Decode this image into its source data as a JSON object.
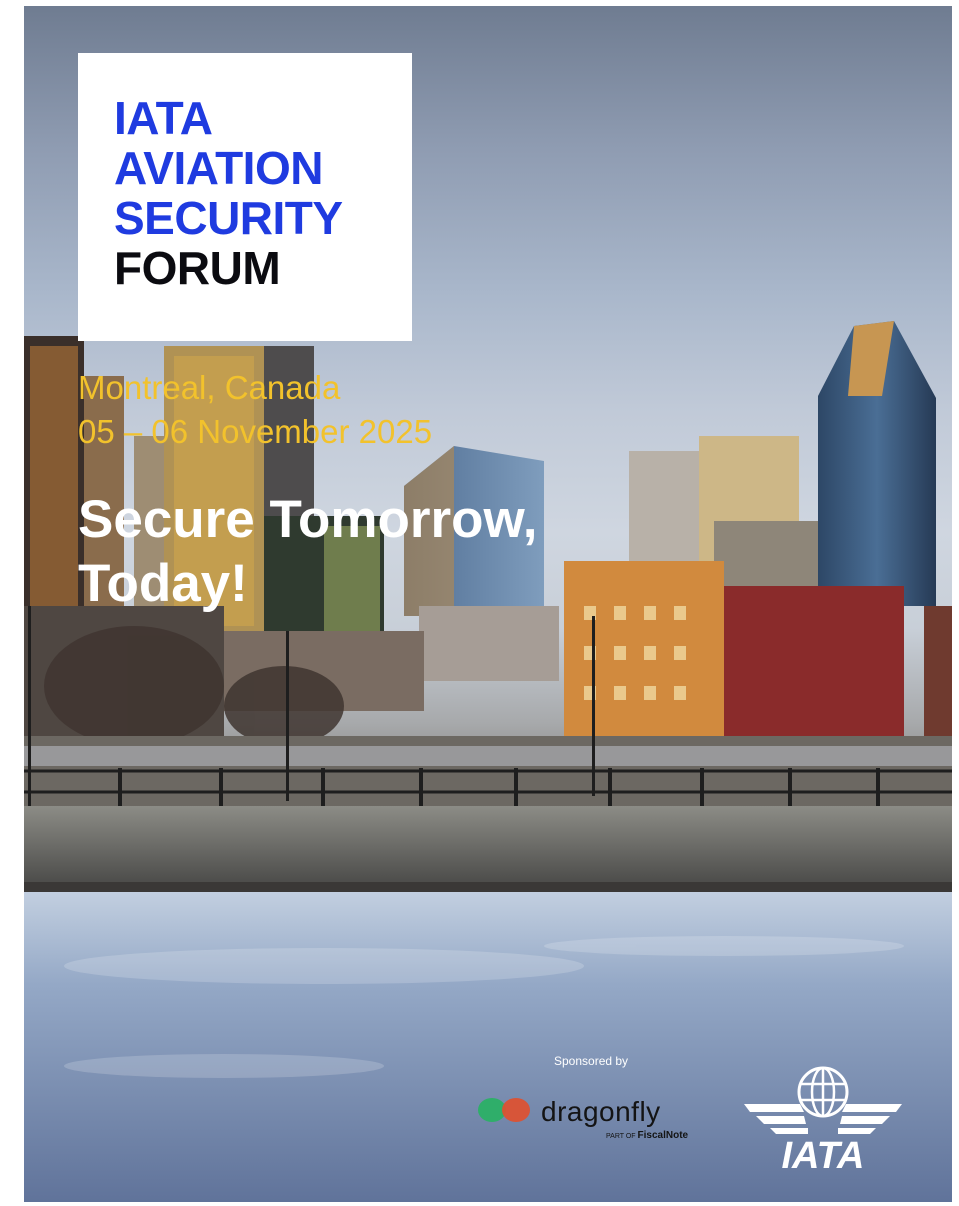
{
  "title_lines": [
    "IATA",
    "AVIATION",
    "SECURITY",
    "FORUM"
  ],
  "location": "Montreal, Canada",
  "dates": "05 – 06 November 2025",
  "tagline_line1": "Secure Tomorrow,",
  "tagline_line2": "Today!",
  "sponsor": {
    "label": "Sponsored by",
    "name": "dragonfly",
    "sub_prefix": "PART OF",
    "sub_brand": "FiscalNote"
  },
  "organizer_logo": "IATA",
  "colors": {
    "title_blue": "#1f3be0",
    "title_dark": "#0b0b10",
    "accent_yellow": "#f2c22c",
    "text_white": "#ffffff"
  },
  "icons": [
    "dragonfly-logo-icon",
    "iata-globe-wings-icon"
  ]
}
